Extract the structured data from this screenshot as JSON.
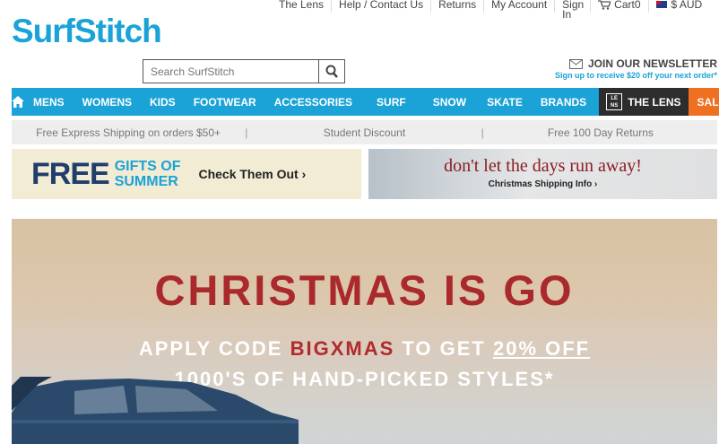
{
  "toplinks": {
    "lens": "The Lens",
    "help": "Help / Contact Us",
    "returns": "Returns",
    "account": "My Account",
    "signin": "Sign In",
    "cart": "Cart0",
    "currency": "$ AUD"
  },
  "logo": {
    "text": "SurfStitch"
  },
  "search": {
    "placeholder": "Search SurfStitch"
  },
  "newsletter": {
    "title": "JOIN OUR NEWSLETTER",
    "subtitle": "Sign up to receive $20 off your next order*"
  },
  "nav": {
    "items": [
      "MENS",
      "WOMENS",
      "KIDS",
      "FOOTWEAR",
      "ACCESSORIES",
      "SURF",
      "SNOW",
      "SKATE",
      "BRANDS"
    ],
    "lens": "THE LENS",
    "sale": "SALE"
  },
  "strip": {
    "shipping": "Free Express Shipping on orders $50+",
    "student": "Student Discount",
    "returns": "Free 100 Day Returns",
    "separator": "|"
  },
  "promo_gifts": {
    "free": "FREE",
    "gifts_line1": "GIFTS OF",
    "gifts_line2": "SUMMER",
    "cta": "Check Them Out ›"
  },
  "promo_shipping": {
    "headline": "don't let the days run away!",
    "cta": "Christmas Shipping Info ›"
  },
  "hero": {
    "title": "CHRISTMAS IS GO",
    "line2_pre": "APPLY CODE ",
    "code": "BIGXMAS",
    "line2_mid": " TO GET ",
    "line2_off": "20% OFF",
    "line3": "1000'S OF HAND-PICKED STYLES*"
  },
  "colors": {
    "brand_blue": "#1ba3d7",
    "sale_orange": "#f07022",
    "lens_dark": "#2d2d2d",
    "hero_red": "#a9292c"
  }
}
